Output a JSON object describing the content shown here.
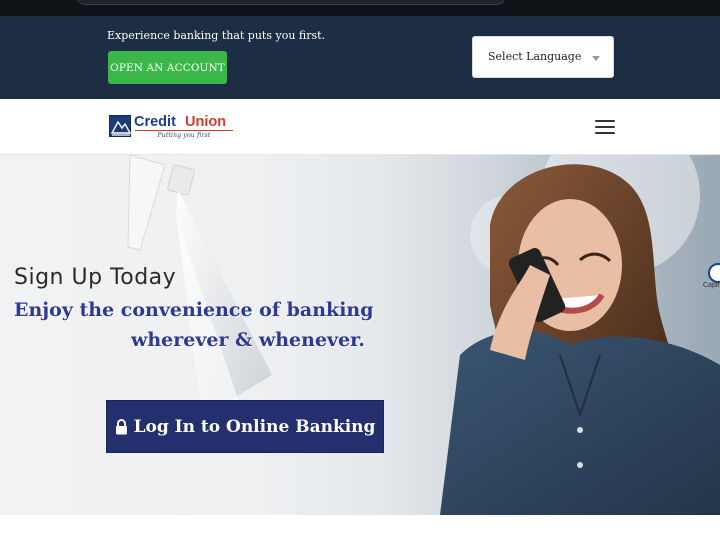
{
  "announce": {
    "tagline": "Experience banking that puts you first.",
    "open_account_label": "OPEN AN ACCOUNT",
    "language_select": {
      "selected": "Select Language"
    }
  },
  "header": {
    "logo": {
      "word1": "Credit",
      "word2": "Union",
      "slogan": "Putting you first"
    },
    "menu_icon": "hamburger-icon"
  },
  "hero": {
    "signup": "Sign Up Today",
    "line1": "Enjoy the convenience of banking",
    "line2": "wherever & whenever.",
    "login_label": "Log In to Online Banking",
    "login_icon": "lock-icon",
    "side_badge_text": "Capit"
  },
  "colors": {
    "navy_bar": "#1d2d43",
    "green_button": "#3cb84b",
    "login_button": "#24306e",
    "headline_blue": "#2d3a94",
    "logo_red": "#d63a2a"
  }
}
